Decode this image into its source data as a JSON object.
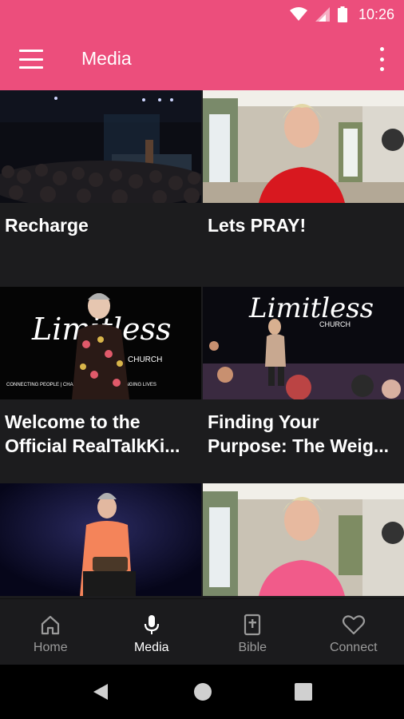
{
  "status_bar": {
    "time": "10:26"
  },
  "app_bar": {
    "title": "Media"
  },
  "media_items": [
    {
      "title": "Recharge"
    },
    {
      "title": "Lets PRAY!"
    },
    {
      "title": "Welcome to the Official RealTalkKi..."
    },
    {
      "title": "Finding Your Purpose: The Weig..."
    },
    {
      "title": ""
    },
    {
      "title": ""
    }
  ],
  "thumb_text": {
    "limitless": "Limitless",
    "church": "CHURCH",
    "tagline": "CONNECTING PEOPLE | CHANGING FAMILIES | CHANGING LIVES"
  },
  "bottom_nav": {
    "items": [
      {
        "label": "Home",
        "icon": "home-icon"
      },
      {
        "label": "Media",
        "icon": "microphone-icon"
      },
      {
        "label": "Bible",
        "icon": "bible-icon"
      },
      {
        "label": "Connect",
        "icon": "heart-icon"
      }
    ],
    "active": "Media"
  },
  "colors": {
    "accent": "#ec4e7c",
    "background": "#1c1c1e",
    "nav_inactive": "#9a9a9a"
  }
}
